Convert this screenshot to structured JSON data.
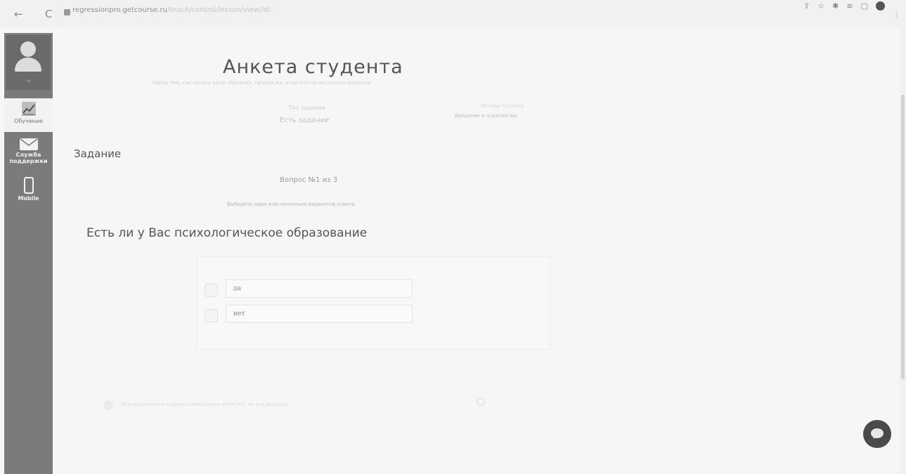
{
  "browser": {
    "back_glyph": "←",
    "reload_glyph": "C",
    "url_domain": "regressionpro.getcourse.ru",
    "url_rest": "/teach/control/lesson/view/id/",
    "toolbar_icons": [
      "share-icon",
      "star-icon",
      "extensions-icon",
      "reading-list-icon",
      "window-icon",
      "profile-icon"
    ],
    "more_glyph": "⋮"
  },
  "sidebar": {
    "avatar_exit": "⇥",
    "items": [
      {
        "label": "Обучение",
        "icon": "chart-icon"
      },
      {
        "label": "Служба поддержки",
        "icon": "mail-icon"
      },
      {
        "label": "Mobile",
        "icon": "phone-icon"
      }
    ]
  },
  "page": {
    "title": "Анкета студента",
    "subtitle": "Перед тем, как начать ваше обучение, просим вас ответить на несколько вопросов",
    "meta": {
      "type_label": "Тип задания",
      "type_value": "Есть задание",
      "lesson_label": "Основы подхода",
      "lesson_value": "Введение в психологию"
    },
    "section_title": "Задание",
    "question": {
      "number": "Вопрос №1 из 3",
      "hint": "Выберите один или несколько вариантов ответа",
      "text": "Есть ли у Вас психологическое образование",
      "answers": [
        {
          "label": "да",
          "checked": false
        },
        {
          "label": "нет",
          "checked": false
        }
      ]
    },
    "footer_note": "Для выполнения задания необходимо ответить на все вопросы"
  },
  "colors": {
    "sidebar_bg": "#7b7b7b",
    "page_bg": "#f6f6f6",
    "chat_button": "#4a4a4a"
  }
}
